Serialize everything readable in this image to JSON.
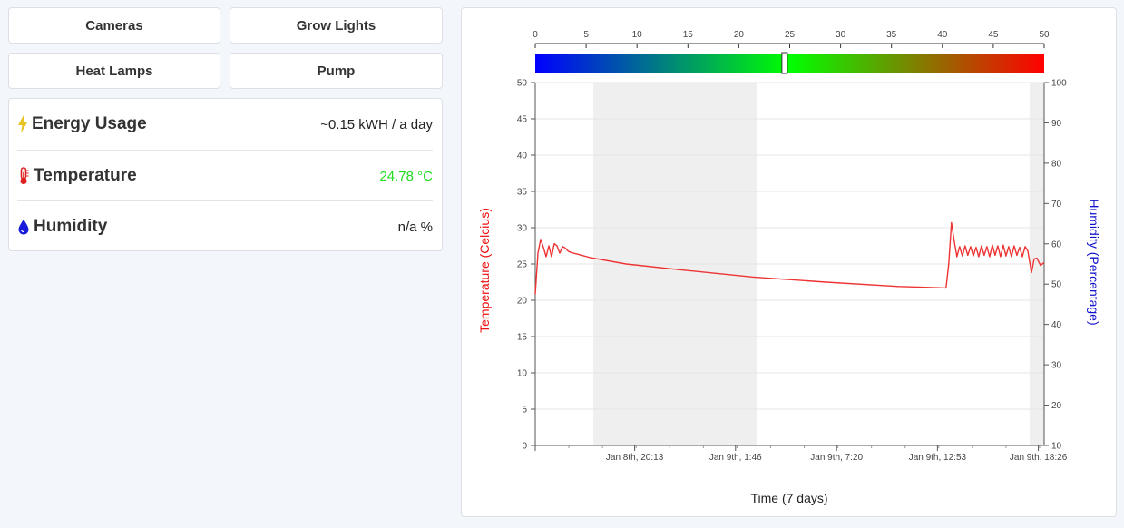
{
  "buttons": {
    "cameras": "Cameras",
    "grow_lights": "Grow Lights",
    "heat_lamps": "Heat Lamps",
    "pump": "Pump"
  },
  "stats": {
    "energy": {
      "label": "Energy Usage",
      "value": "~0.15 kWH / a day",
      "icon": "lightning-icon",
      "icon_color": "#e6c31e"
    },
    "temperature": {
      "label": "Temperature",
      "value": "24.78 °C",
      "icon": "thermometer-icon",
      "icon_color": "#e02020",
      "value_color": "#22dd22"
    },
    "humidity": {
      "label": "Humidity",
      "value": "n/a %",
      "icon": "water-drop-icon",
      "icon_color": "#1a1adb"
    }
  },
  "colors": {
    "temperature_line": "#ee3333",
    "left_axis_label": "#ee1111",
    "right_axis_label": "#1111cc",
    "shade": "#efefef",
    "gauge_gradient": [
      "#0000ff",
      "#00ff00",
      "#ff0000"
    ]
  },
  "chart_data": {
    "type": "line",
    "gauge": {
      "ticks": [
        0,
        5,
        10,
        15,
        20,
        25,
        30,
        35,
        40,
        45,
        50
      ],
      "range": [
        0,
        50
      ],
      "marker_value": 24.5
    },
    "xlabel": "Time (7 days)",
    "ylabel_left": "Temperature (Celcius)",
    "ylabel_right": "Humidity (Percentage)",
    "ylim_left": [
      0,
      50
    ],
    "ylim_right": [
      10,
      100
    ],
    "y_ticks_left": [
      0,
      5,
      10,
      15,
      20,
      25,
      30,
      35,
      40,
      45,
      50
    ],
    "y_ticks_right": [
      10,
      20,
      30,
      40,
      50,
      60,
      70,
      80,
      90,
      100
    ],
    "x_tick_labels": [
      "Jan 8th, 20:13",
      "Jan 9th, 1:46",
      "Jan 9th, 7:20",
      "Jan 9th, 12:53",
      "Jan 9th, 18:26"
    ],
    "x_tick_hours": [
      5.47,
      11.02,
      16.58,
      22.13,
      27.68
    ],
    "x_range_hours": [
      0,
      28.0
    ],
    "shaded_ranges_hours": [
      [
        3.2,
        12.2
      ],
      [
        27.2,
        28.0
      ]
    ],
    "grid": true,
    "series": [
      {
        "x": [
          0,
          0.15,
          0.3,
          0.45,
          0.6,
          0.75,
          0.9,
          1.05,
          1.2,
          1.35,
          1.5,
          1.65,
          1.8,
          1.95,
          2.1,
          2.25,
          2.4,
          2.55,
          2.7,
          2.85,
          3.0,
          3.2,
          5,
          8,
          12,
          16,
          20,
          22.6,
          22.75,
          22.9,
          23.05,
          23.2,
          23.35,
          23.5,
          23.65,
          23.8,
          23.95,
          24.1,
          24.25,
          24.4,
          24.55,
          24.7,
          24.85,
          25.0,
          25.15,
          25.3,
          25.45,
          25.6,
          25.75,
          25.9,
          26.05,
          26.2,
          26.35,
          26.5,
          26.65,
          26.8,
          26.95,
          27.1,
          27.3,
          27.45,
          27.6,
          27.8,
          28.0
        ],
        "y": [
          20.8,
          26.5,
          28.4,
          27.3,
          26.0,
          27.5,
          26.0,
          27.8,
          27.5,
          26.5,
          27.4,
          27.2,
          26.8,
          26.6,
          26.5,
          26.4,
          26.3,
          26.2,
          26.1,
          26.0,
          25.9,
          25.8,
          25.0,
          24.2,
          23.2,
          22.5,
          21.9,
          21.7,
          25.0,
          30.7,
          28.2,
          26.0,
          27.4,
          26.1,
          27.5,
          26.2,
          27.4,
          26.1,
          27.3,
          26.0,
          27.5,
          26.2,
          27.4,
          26.0,
          27.6,
          26.2,
          27.5,
          26.0,
          27.6,
          26.1,
          27.4,
          26.0,
          27.5,
          26.2,
          27.3,
          26.0,
          27.4,
          26.8,
          23.8,
          25.7,
          25.8,
          24.8,
          25.2
        ]
      }
    ]
  }
}
